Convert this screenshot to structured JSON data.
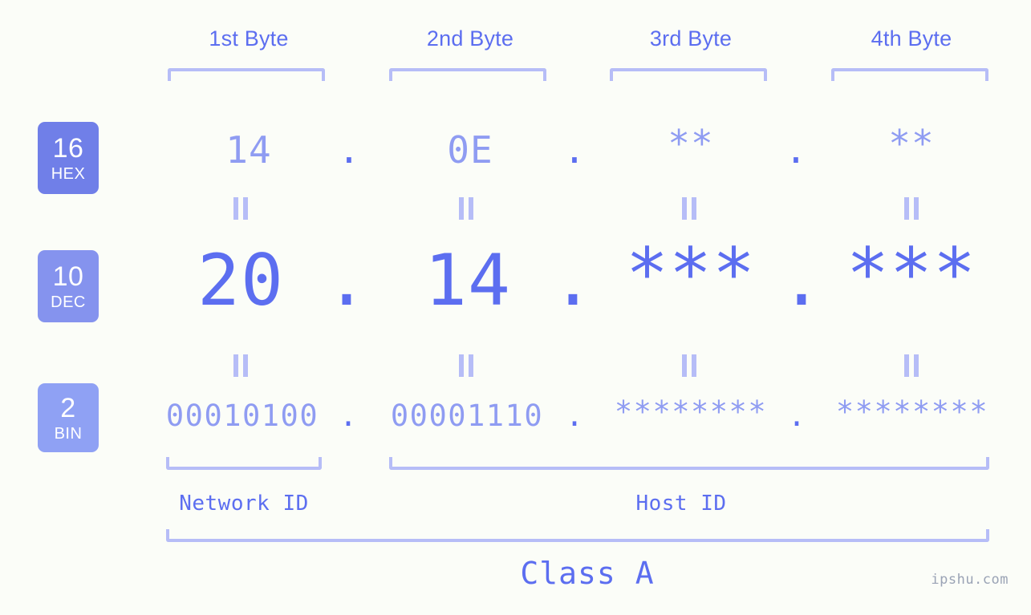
{
  "headers": [
    {
      "label": "1st Byte"
    },
    {
      "label": "2nd Byte"
    },
    {
      "label": "3rd Byte"
    },
    {
      "label": "4th Byte"
    }
  ],
  "bases": [
    {
      "number": "16",
      "name": "HEX",
      "color": "#707fe8"
    },
    {
      "number": "10",
      "name": "DEC",
      "color": "#8593ee"
    },
    {
      "number": "2",
      "name": "BIN",
      "color": "#8fa1f4"
    }
  ],
  "rows": {
    "hex": {
      "bytes": [
        "14",
        "0E",
        "**",
        "**"
      ],
      "separator": "."
    },
    "dec": {
      "bytes": [
        "20",
        "14",
        "***",
        "***"
      ],
      "separator": "."
    },
    "bin": {
      "bytes": [
        "00010100",
        "00001110",
        "********",
        "********"
      ],
      "separator": "."
    }
  },
  "segments": {
    "network_id": "Network ID",
    "host_id": "Host ID",
    "class": "Class A"
  },
  "watermark": "ipshu.com",
  "colors": {
    "background": "#fbfdf8",
    "accent_strong": "#5c6ef0",
    "accent_mid": "#8f9cf2",
    "accent_light": "#b6bdf7"
  }
}
